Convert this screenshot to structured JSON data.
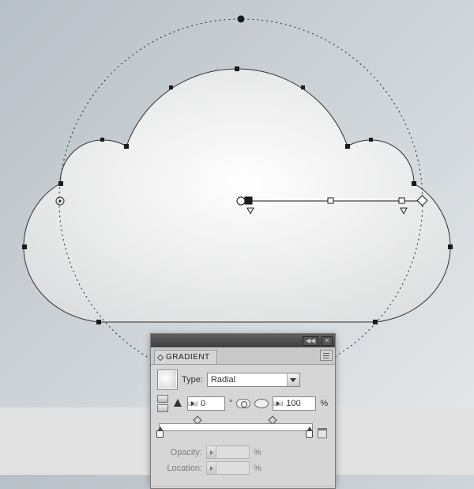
{
  "panel": {
    "title": "GRADIENT",
    "type_label": "Type:",
    "type_value": "Radial",
    "angle_value": "0",
    "angle_unit": "°",
    "aspect_value": "100",
    "aspect_unit": "%",
    "opacity_label": "Opacity:",
    "opacity_unit": "%",
    "location_label": "Location:",
    "location_unit": "%",
    "collapse_glyph": "◀◀",
    "close_glyph": "✕"
  },
  "colors": {
    "bg_gradient_a": "#b8c0c7",
    "bg_gradient_b": "#e6e9eb",
    "ground": "#e1e1e1",
    "panel_bg": "#d6d6d6"
  }
}
